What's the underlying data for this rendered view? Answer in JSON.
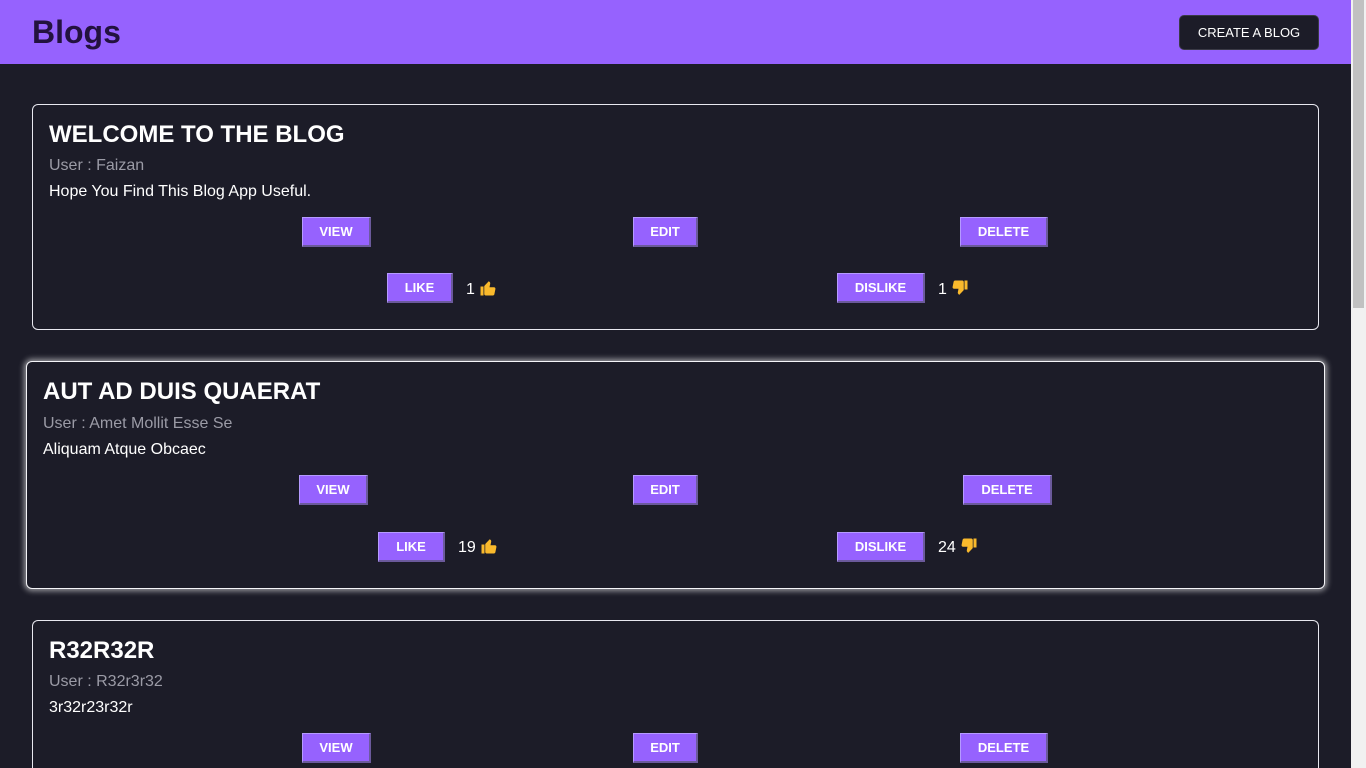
{
  "header": {
    "title": "Blogs",
    "create_label": "CREATE A BLOG"
  },
  "labels": {
    "view": "VIEW",
    "edit": "EDIT",
    "delete": "DELETE",
    "like": "LIKE",
    "dislike": "DISLIKE"
  },
  "blogs": [
    {
      "title": "WELCOME TO THE BLOG",
      "user": "User : Faizan",
      "body": "Hope You Find This Blog App Useful.",
      "likes": "1",
      "dislikes": "1"
    },
    {
      "title": "AUT AD DUIS QUAERAT",
      "user": "User : Amet Mollit Esse Se",
      "body": "Aliquam Atque Obcaec",
      "likes": "19",
      "dislikes": "24"
    },
    {
      "title": "R32R32R",
      "user": "User : R32r3r32",
      "body": "3r32r23r32r"
    }
  ],
  "colors": {
    "accent": "#9662fe",
    "background": "#1c1c28",
    "thumb": "#f9b92c"
  },
  "icons": {
    "like": "thumbs-up-icon",
    "dislike": "thumbs-down-icon"
  }
}
